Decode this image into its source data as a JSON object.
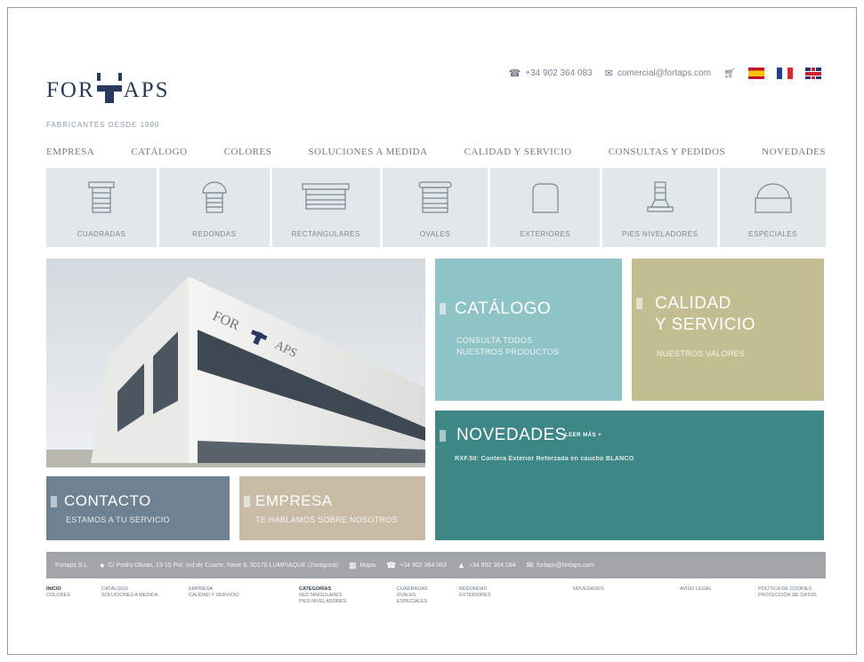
{
  "header": {
    "logo_left": "FOR",
    "logo_right": "APS",
    "tagline": "FABRICANTES DESDE 1990",
    "phone": "+34 902 364 083",
    "email": "comercial@fortaps.com",
    "languages": [
      "es",
      "fr",
      "en"
    ]
  },
  "nav": {
    "items": [
      "EMPRESA",
      "CATÁLOGO",
      "COLORES",
      "SOLUCIONES A MEDIDA",
      "CALIDAD Y SERVICIO",
      "CONSULTAS Y PEDIDOS",
      "NOVEDADES"
    ]
  },
  "categories": [
    {
      "label": "CUADRADAS",
      "icon": "square-cap-icon"
    },
    {
      "label": "REDONDAS",
      "icon": "round-cap-icon"
    },
    {
      "label": "RECTANGULARES",
      "icon": "rectangular-cap-icon"
    },
    {
      "label": "OVALES",
      "icon": "oval-cap-icon"
    },
    {
      "label": "EXTERIORES",
      "icon": "exterior-cap-icon"
    },
    {
      "label": "PIES NIVELADORES",
      "icon": "leveling-foot-icon"
    },
    {
      "label": "ESPECIALES",
      "icon": "special-cap-icon"
    }
  ],
  "hero": {
    "sign_left": "FOR",
    "sign_right": "APS"
  },
  "tiles": {
    "catalogo": {
      "title": "CATÁLOGO",
      "line1": "CONSULTA TODOS",
      "line2": "NUESTROS PRODUCTOS"
    },
    "calidad": {
      "title_line1": "CALIDAD",
      "title_line2": "Y SERVICIO",
      "sub": "NUESTROS VALORES"
    },
    "novedades": {
      "title": "NOVEDADES",
      "more": "LEER MÁS +",
      "news": "RXF.50: Contera Exterior Reforzada en caucho BLANCO"
    },
    "contacto": {
      "title": "CONTACTO",
      "sub": "ESTAMOS A TU SERVICIO"
    },
    "empresa": {
      "title": "EMPRESA",
      "sub": "TE HABLAMOS SOBRE NOSOTROS"
    }
  },
  "footer": {
    "company": "Fortaps S.L.",
    "address": "C/ Pedro Olivan, 13-15 Pol. Ind de Cuarte, Nave 8, 50170 LUMPIAQUE (Zaragoza)",
    "map": "Mapa",
    "phone": "+34 902 364 083",
    "fax": "+34 902 364 084",
    "email": "fortaps@fortaps.com"
  },
  "sitemap": [
    {
      "lines": [
        "INICIO",
        "COLORES"
      ],
      "bold_first": true
    },
    {
      "lines": [
        "CATÁLOGO",
        "SOLUCIONES A MEDIDA"
      ],
      "bold_first": false
    },
    {
      "lines": [
        "EMPRESA",
        "CALIDAD Y SERVICIO"
      ],
      "bold_first": false
    },
    {
      "lines": [
        "CATEGORÍAS",
        "RECTANGULARES",
        "PIES NIVELADORES"
      ],
      "bold_first": true
    },
    {
      "lines": [
        "CUADRADAS",
        "OVALES",
        "ESPECIALES"
      ],
      "bold_first": false
    },
    {
      "lines": [
        "REDONDAS",
        "EXTERIORES"
      ],
      "bold_first": false
    },
    {
      "lines": [
        "NOVEDADES"
      ],
      "bold_first": false
    },
    {
      "lines": [
        "AVISO LEGAL"
      ],
      "bold_first": false
    },
    {
      "lines": [
        "POLÍTICA DE COOKIES",
        "PROTECCIÓN DE DATOS"
      ],
      "bold_first": false
    }
  ],
  "colors": {
    "catalogo": "#8fc4c6",
    "calidad": "#c3be92",
    "novedades": "#3d8786",
    "contacto": "#6e8291",
    "empresa": "#c8bca6",
    "brand": "#2a3a5c"
  }
}
